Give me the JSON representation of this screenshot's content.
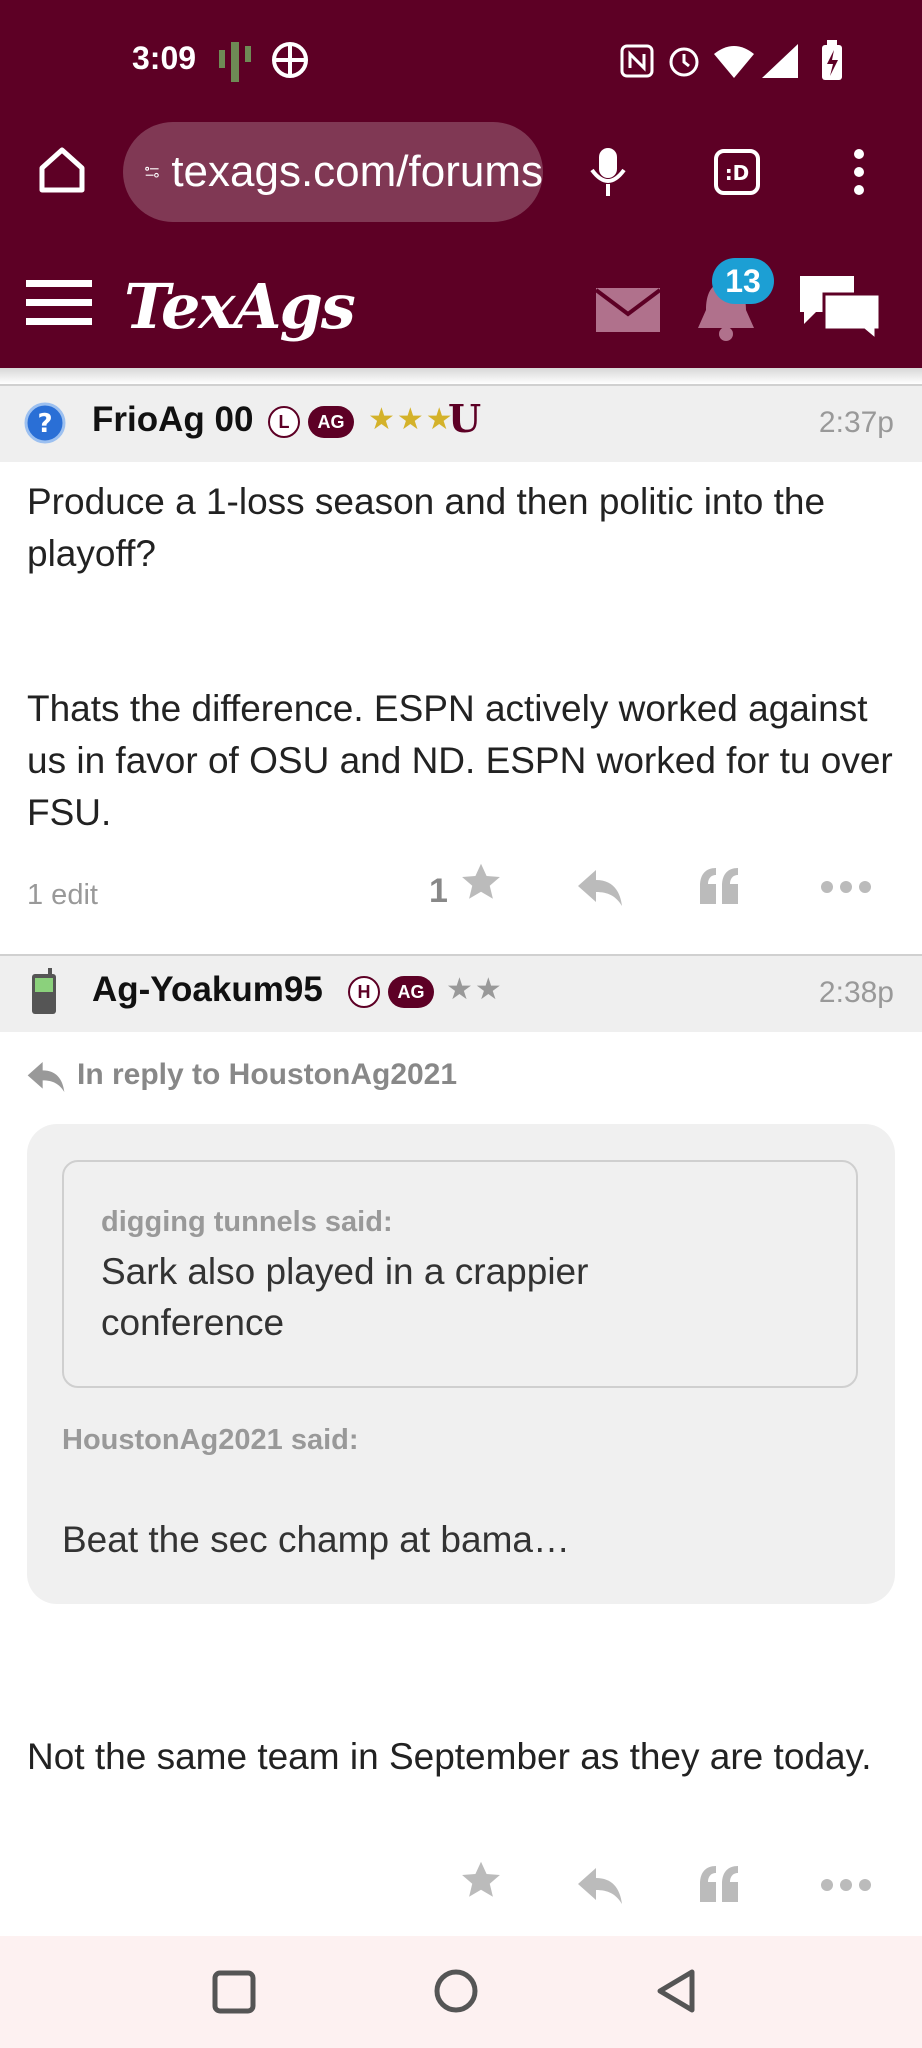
{
  "status_bar": {
    "time": "3:09"
  },
  "browser": {
    "url": "texags.com/forums"
  },
  "site": {
    "logo": "TexAgs",
    "notification_count": "13"
  },
  "posts": [
    {
      "username": "FrioAg 00",
      "badge_l": "L",
      "badge_ag": "AG",
      "stars": "★★★",
      "time": "2:37p",
      "body_1": "Produce a 1-loss season and then politic into the playoff?",
      "body_2": "Thats the difference. ESPN actively worked against us in favor of OSU and ND. ESPN worked for tu over FSU.",
      "edits": "1 edit",
      "likes": "1"
    },
    {
      "username": "Ag-Yoakum95",
      "badge_h": "H",
      "badge_ag": "AG",
      "stars": "★★",
      "time": "2:38p",
      "reply_to": "In reply to HoustonAg2021",
      "inner_quote_author": "digging tunnels said:",
      "inner_quote_text": "Sark also played in a crappier conference",
      "outer_quote_author": "HoustonAg2021 said:",
      "outer_quote_text": "Beat the sec champ at bama…",
      "body": "Not the same team in September as they are today."
    }
  ]
}
